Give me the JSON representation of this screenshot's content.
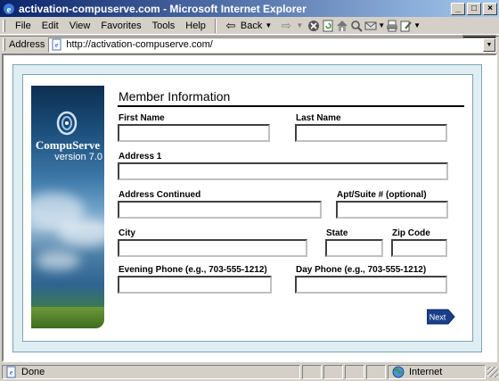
{
  "window": {
    "title": "activation-compuserve.com - Microsoft Internet Explorer",
    "min_label": "_",
    "max_label": "□",
    "close_label": "×"
  },
  "menu": {
    "items": [
      "File",
      "Edit",
      "View",
      "Favorites",
      "Tools",
      "Help"
    ]
  },
  "toolbar": {
    "back_label": "Back"
  },
  "address": {
    "label": "Address",
    "url": "http://activation-compuserve.com/"
  },
  "banner": {
    "brand": "CompuServe",
    "version": "version 7.0"
  },
  "form": {
    "title": "Member Information",
    "first_name_label": "First Name",
    "last_name_label": "Last Name",
    "address1_label": "Address 1",
    "address_cont_label": "Address Continued",
    "apt_label": "Apt/Suite # (optional)",
    "city_label": "City",
    "state_label": "State",
    "zip_label": "Zip Code",
    "evening_phone_label": "Evening Phone (e.g., 703-555-1212)",
    "day_phone_label": "Day Phone (e.g., 703-555-1212)",
    "first_name_value": "",
    "last_name_value": "",
    "address1_value": "",
    "address_cont_value": "",
    "apt_value": "",
    "city_value": "",
    "state_value": "",
    "zip_value": "",
    "evening_phone_value": "",
    "day_phone_value": "",
    "next_label": "Next"
  },
  "status": {
    "text": "Done",
    "zone": "Internet"
  },
  "colors": {
    "title_bar": "#0a246a",
    "page_background": "#dfeef2",
    "next_button": "#1a3f8a"
  }
}
